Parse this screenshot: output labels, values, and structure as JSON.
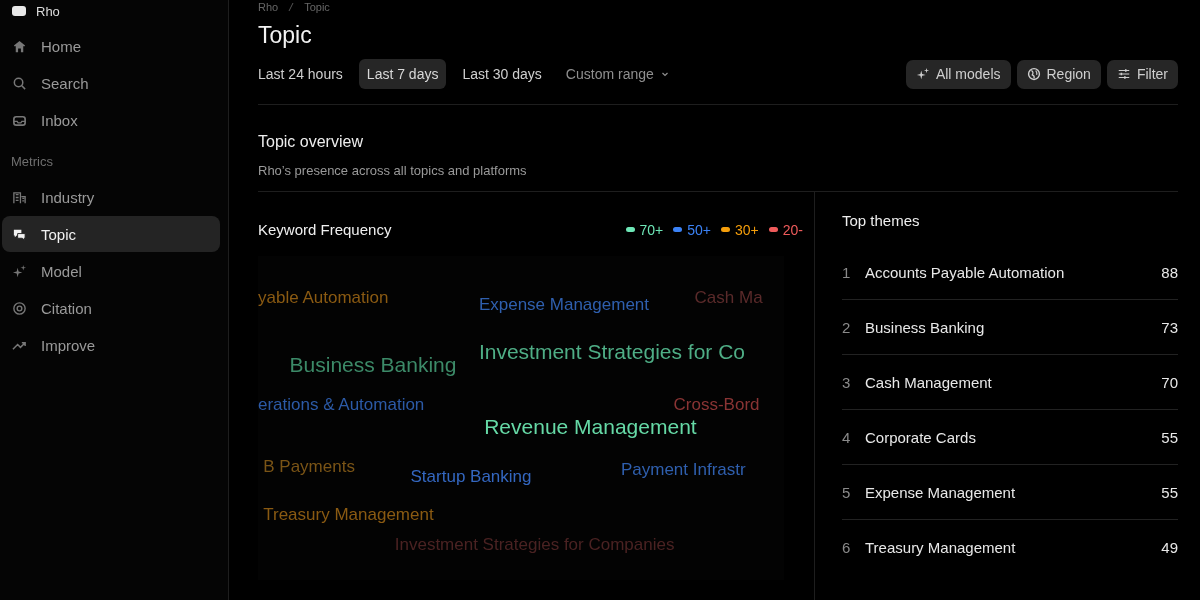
{
  "sidebar": {
    "brand": "Rho",
    "items": [
      {
        "label": "Home",
        "selected": false
      },
      {
        "label": "Search",
        "selected": false
      },
      {
        "label": "Inbox",
        "selected": false
      }
    ],
    "section": "Metrics",
    "metrics": [
      {
        "label": "Industry",
        "selected": false
      },
      {
        "label": "Topic",
        "selected": true
      },
      {
        "label": "Model",
        "selected": false
      },
      {
        "label": "Citation",
        "selected": false
      },
      {
        "label": "Improve",
        "selected": false
      }
    ]
  },
  "breadcrumb": [
    "Rho",
    "Topic"
  ],
  "page_title": "Topic",
  "ranges": [
    {
      "label": "Last 24 hours",
      "selected": false
    },
    {
      "label": "Last 7 days",
      "selected": true
    },
    {
      "label": "Last 30 days",
      "selected": false
    }
  ],
  "custom_range": "Custom range",
  "toolbar": [
    {
      "label": "All models"
    },
    {
      "label": "Region"
    },
    {
      "label": "Filter"
    }
  ],
  "overview": {
    "title": "Topic overview",
    "subtitle": "Rho’s presence across all topics and platforms"
  },
  "keyword_frequency": {
    "title": "Keyword Frequency",
    "legend": [
      {
        "label": "70+",
        "color": "#6ee7b7"
      },
      {
        "label": "50+",
        "color": "#3b82f6"
      },
      {
        "label": "30+",
        "color": "#f59e0b"
      },
      {
        "label": "20-",
        "color": "#ef5b5b"
      }
    ],
    "words": [
      {
        "text": "yable Automation",
        "color": "#8a5a12"
      },
      {
        "text": "Expense Management",
        "color": "#2f5fae"
      },
      {
        "text": "Cash Ma",
        "color": "#5a2a2a"
      },
      {
        "text": "Business Banking",
        "color": "#3c8a68"
      },
      {
        "text": "Investment Strategies for Co",
        "color": "#4fae86"
      },
      {
        "text": "erations & Automation",
        "color": "#2c5aa6"
      },
      {
        "text": "Cross-Bord",
        "color": "#8a3434"
      },
      {
        "text": "Revenue Management",
        "color": "#66d9a6"
      },
      {
        "text": "B Payments",
        "color": "#7a5416"
      },
      {
        "text": "Startup Banking",
        "color": "#3467c0"
      },
      {
        "text": "Payment Infrastr",
        "color": "#2f5fae"
      },
      {
        "text": "Treasury Management",
        "color": "#8a5a12"
      },
      {
        "text": "Investment Strategies for Companies",
        "color": "#4a2222"
      }
    ]
  },
  "top_themes": {
    "title": "Top themes",
    "rows": [
      {
        "rank": "1",
        "name": "Accounts Payable Automation",
        "value": "88"
      },
      {
        "rank": "2",
        "name": "Business Banking",
        "value": "73"
      },
      {
        "rank": "3",
        "name": "Cash Management",
        "value": "70"
      },
      {
        "rank": "4",
        "name": "Corporate Cards",
        "value": "55"
      },
      {
        "rank": "5",
        "name": "Expense Management",
        "value": "55"
      },
      {
        "rank": "6",
        "name": "Treasury Management",
        "value": "49"
      }
    ]
  }
}
